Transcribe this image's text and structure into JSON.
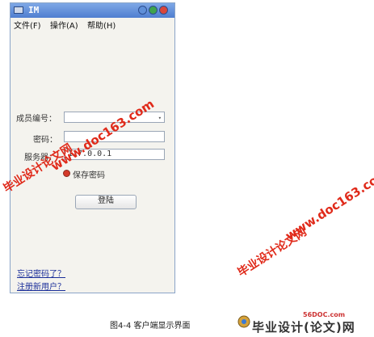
{
  "window": {
    "title": "IM",
    "menu": [
      "文件(F)",
      "操作(A)",
      "帮助(H)"
    ]
  },
  "form": {
    "member_id_label": "成员编号：",
    "member_id_value": "",
    "password_label": "密码：",
    "password_value": "",
    "server_label": "服务器：",
    "server_value": "127.0.0.1",
    "remember_label": "保存密码",
    "login_label": "登陆"
  },
  "links": {
    "forgot": "忘记密码了？",
    "register": "注册新用户？"
  },
  "watermarks": {
    "site1": "www.doc163.com",
    "site2": "毕业设计论文网"
  },
  "caption": "图4-4  客户端显示界面",
  "logo": {
    "url": "56DOC.com",
    "text": "毕业设计(论文)网"
  },
  "colors": {
    "titlebar": "#4f7ed0",
    "watermark": "#e02a1a",
    "link": "#1b2f9a"
  }
}
